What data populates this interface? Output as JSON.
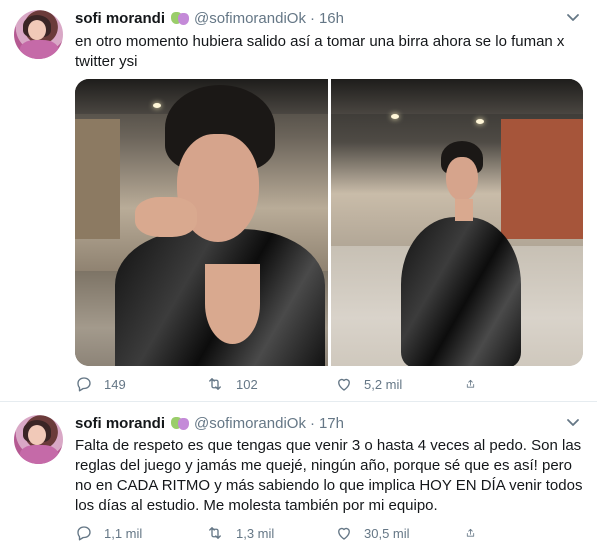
{
  "tweets": [
    {
      "name": "sofi morandi",
      "handle": "@sofimorandiOk",
      "separator": "·",
      "time": "16h",
      "text": "en otro momento hubiera salido así a tomar una birra ahora se lo fuman x twitter ysi",
      "actions": {
        "replies": "149",
        "retweets": "102",
        "likes": "5,2 mil"
      }
    },
    {
      "name": "sofi morandi",
      "handle": "@sofimorandiOk",
      "separator": "·",
      "time": "17h",
      "text": "Falta de respeto es que tengas que venir 3 o hasta 4 veces al pedo. Son las reglas del juego y jamás me quejé, ningún año, porque sé que es así! pero no en CADA RITMO y más sabiendo lo que implica HOY EN DÍA venir todos los días  al estudio. Me molesta también por mi equipo.",
      "actions": {
        "replies": "1,1 mil",
        "retweets": "1,3 mil",
        "likes": "30,5 mil"
      }
    }
  ],
  "icons": {
    "reply": "reply-icon",
    "retweet": "retweet-icon",
    "like": "heart-icon",
    "share": "share-icon",
    "menu": "chevron-down-icon",
    "badge": "theater-masks-emoji"
  },
  "colors": {
    "text": "#14171a",
    "secondary": "#657786",
    "divider": "#e6ecf0"
  }
}
